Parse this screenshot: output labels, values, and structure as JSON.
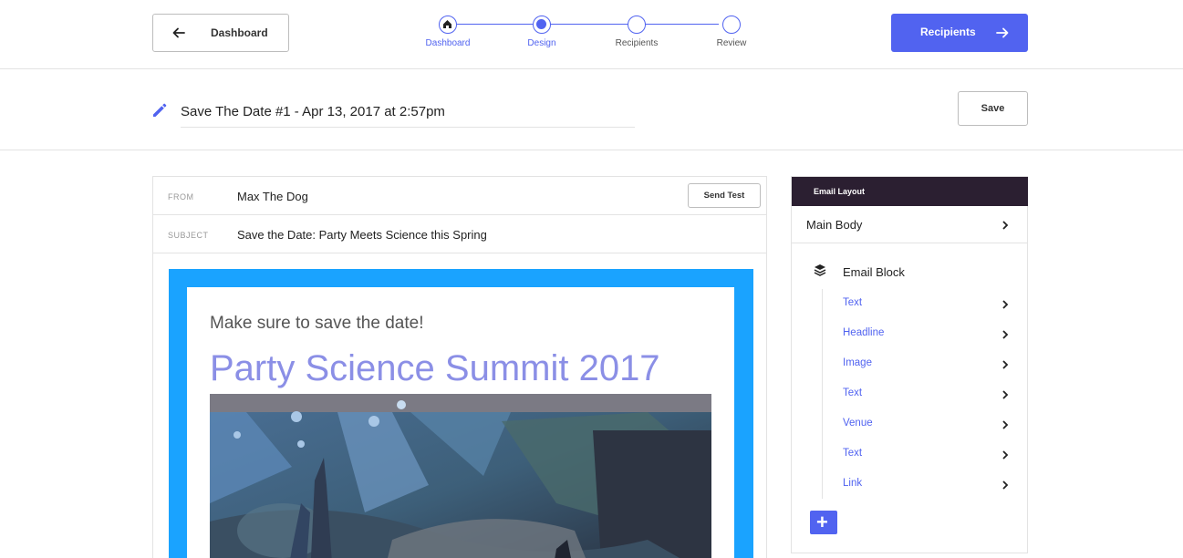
{
  "header": {
    "back_label": "Dashboard",
    "next_label": "Recipients",
    "accent": "#5163f0",
    "steps": [
      {
        "label": "Dashboard",
        "state": "done"
      },
      {
        "label": "Design",
        "state": "active"
      },
      {
        "label": "Recipients",
        "state": "pending"
      },
      {
        "label": "Review",
        "state": "pending"
      }
    ]
  },
  "campaign": {
    "title": "Save The Date #1 - Apr 13, 2017 at 2:57pm",
    "save_label": "Save"
  },
  "email": {
    "from_label": "FROM",
    "from_value": "Max The Dog",
    "send_test_label": "Send Test",
    "subject_label": "SUBJECT",
    "subject_value": "Save the Date: Party Meets Science this Spring",
    "frame_color": "#1aa3ff",
    "pre_headline": "Make sure to save the date!",
    "headline": "Party Science Summit 2017",
    "headline_color": "#8b8fe6"
  },
  "sidebar": {
    "header": "Email Layout",
    "header_color": "#2b1f31",
    "main_body_label": "Main Body",
    "block_label": "Email Block",
    "items": [
      {
        "label": "Text"
      },
      {
        "label": "Headline"
      },
      {
        "label": "Image"
      },
      {
        "label": "Text"
      },
      {
        "label": "Venue"
      },
      {
        "label": "Text"
      },
      {
        "label": "Link"
      }
    ],
    "add_label": "+"
  }
}
